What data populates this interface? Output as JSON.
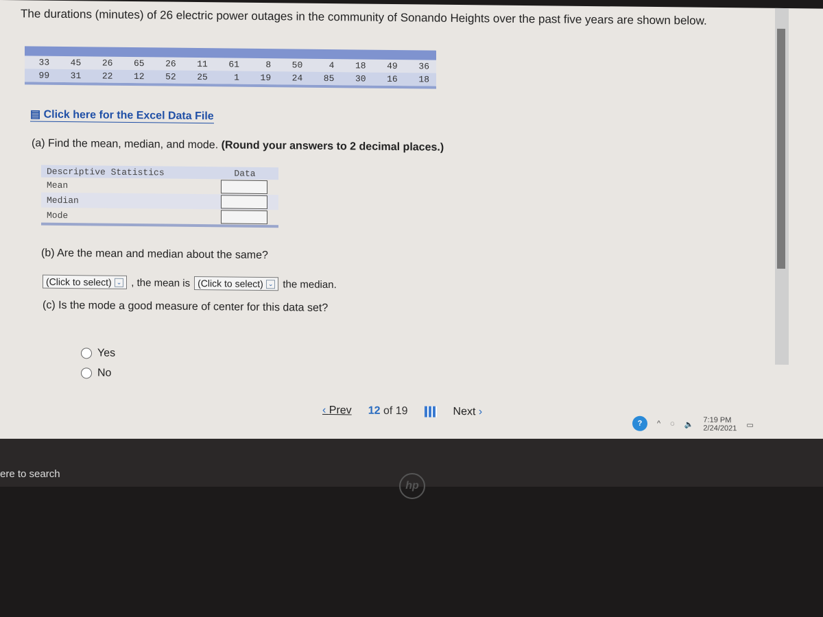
{
  "question": {
    "title": "The durations (minutes) of 26 electric power outages in the community of Sonando Heights over the past five years are shown below.",
    "data_rows": [
      [
        "33",
        "45",
        "26",
        "65",
        "26",
        "11",
        "61",
        "8",
        "50",
        "4",
        "18",
        "49",
        "36"
      ],
      [
        "99",
        "31",
        "22",
        "12",
        "52",
        "25",
        "1",
        "19",
        "24",
        "85",
        "30",
        "16",
        "18"
      ]
    ],
    "excel_link": "Click here for the Excel Data File",
    "part_a": {
      "prompt": "(a) Find the mean, median, and mode.",
      "note": "(Round your answers to 2 decimal places.)"
    },
    "stats_table": {
      "header": "Descriptive Statistics",
      "data_header": "Data",
      "rows": [
        {
          "label": "Mean",
          "value": ""
        },
        {
          "label": "Median",
          "value": ""
        },
        {
          "label": "Mode",
          "value": ""
        }
      ]
    },
    "part_b": {
      "prompt": "(b) Are the mean and median about the same?",
      "select1": "(Click to select)",
      "mid_text": ", the mean is",
      "select2": "(Click to select)",
      "end_text": "the median."
    },
    "part_c": {
      "prompt": "(c) Is the mode a good measure of center for this data set?",
      "options": [
        "Yes",
        "No"
      ]
    }
  },
  "nav": {
    "prev": "Prev",
    "current": "12",
    "of": "of 19",
    "next": "Next"
  },
  "tray": {
    "time": "7:19 PM",
    "date": "2/24/2021"
  },
  "taskbar": {
    "search": "ere to search"
  },
  "hp_logo": "hp"
}
